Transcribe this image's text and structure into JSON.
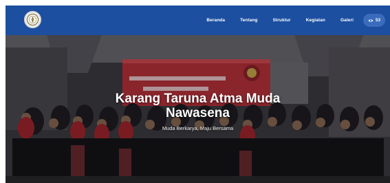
{
  "navbar": {
    "logo_icon": "organization-logo-icon",
    "links": [
      "Beranda",
      "Tentang",
      "Struktur",
      "Kegiatan",
      "Galeri"
    ],
    "visitor_count": "53",
    "visitor_icon": "eye-icon"
  },
  "hero": {
    "banner_text": "semarak kemerdekaan",
    "title_line1": "Karang Taruna Atma Muda",
    "title_line2": "Nawasena",
    "subtitle": "Muda Berkarya, Maju Bersama"
  },
  "colors": {
    "navbar": "#1c4fa0",
    "visitor_badge": "#3a6bbd",
    "banner": "#b8323b"
  }
}
